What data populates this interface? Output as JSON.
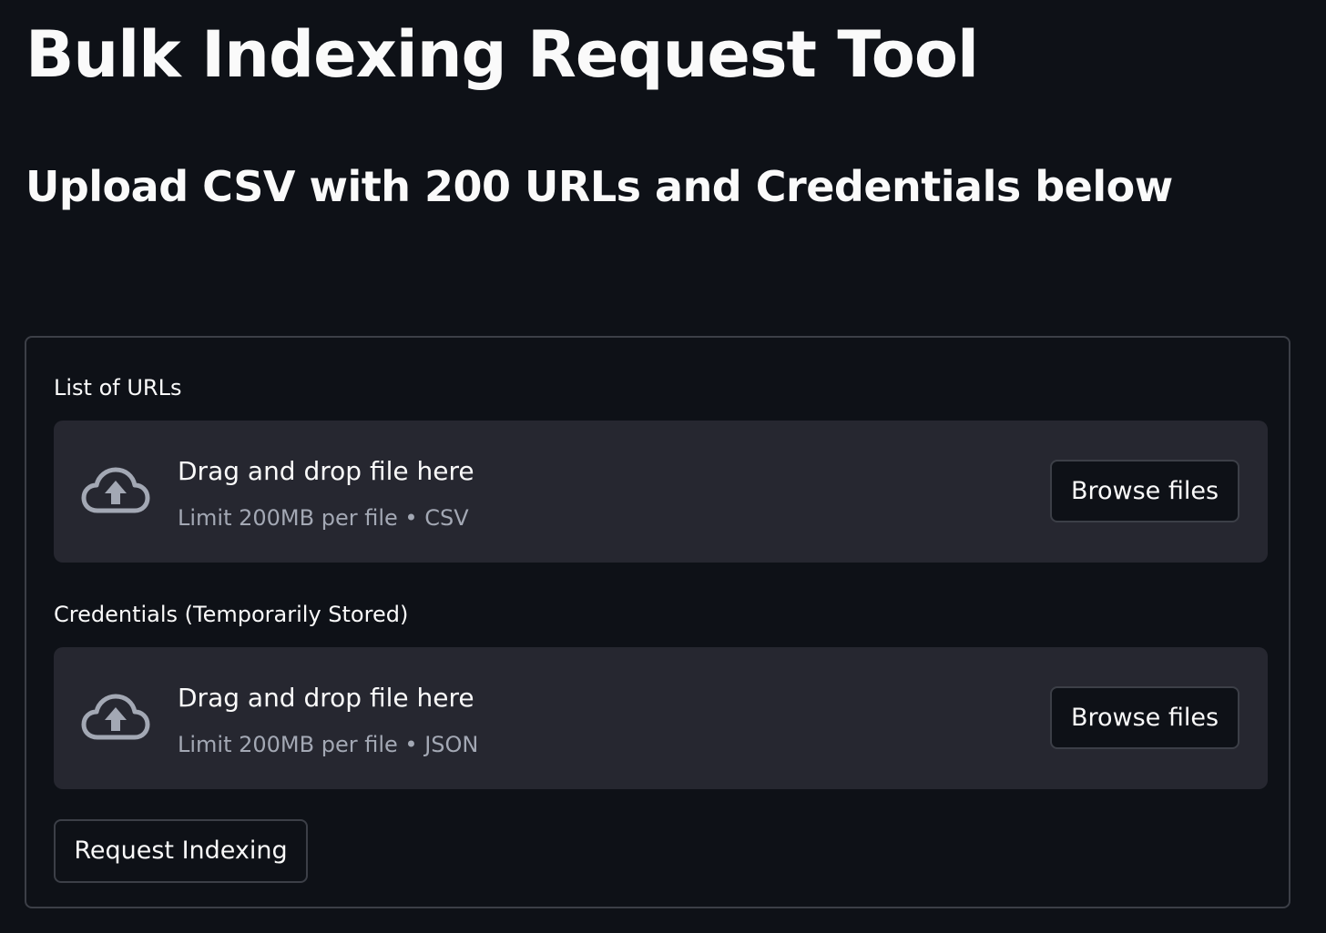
{
  "page": {
    "title": "Bulk Indexing Request Tool",
    "subtitle": "Upload CSV with 200 URLs and Credentials below"
  },
  "form": {
    "uploaders": [
      {
        "label": "List of URLs",
        "drop_title": "Drag and drop file here",
        "limit_text": "Limit 200MB per file • CSV",
        "browse_label": "Browse files",
        "icon": "cloud-upload-icon"
      },
      {
        "label": "Credentials (Temporarily Stored)",
        "drop_title": "Drag and drop file here",
        "limit_text": "Limit 200MB per file • JSON",
        "browse_label": "Browse files",
        "icon": "cloud-upload-icon"
      }
    ],
    "submit_label": "Request Indexing"
  },
  "colors": {
    "background": "#0e1117",
    "dropzone": "#262730",
    "border": "#3c3f47",
    "text": "#fafafa",
    "muted_text": "#a3a8b4",
    "icon": "#a3a8b4"
  }
}
